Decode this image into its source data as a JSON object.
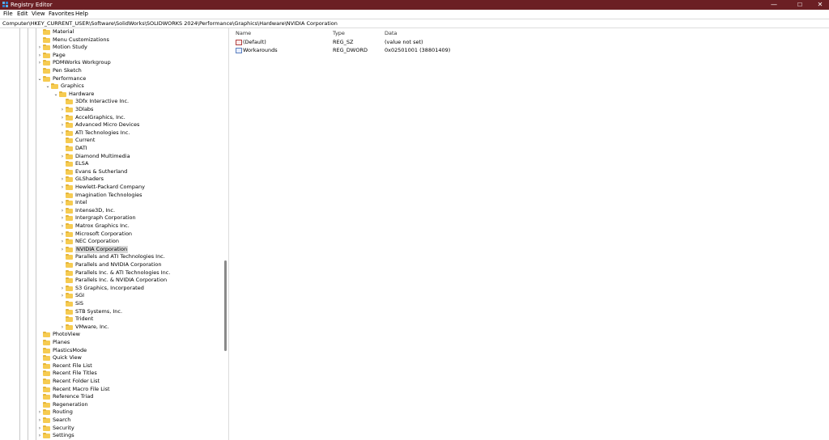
{
  "window": {
    "title": "Registry Editor",
    "controls": {
      "minimize": "—",
      "maximize": "☐",
      "close": "✕"
    }
  },
  "menu": [
    "File",
    "Edit",
    "View",
    "Favorites",
    "Help"
  ],
  "address": "Computer\\HKEY_CURRENT_USER\\Software\\SolidWorks\\SOLIDWORKS 2024\\Performance\\Graphics\\Hardware\\NVIDIA Corporation",
  "tree": [
    {
      "label": "Material",
      "level": 0,
      "expander": ""
    },
    {
      "label": "Menu Customizations",
      "level": 0,
      "expander": ""
    },
    {
      "label": "Motion Study",
      "level": 0,
      "expander": "collapsed"
    },
    {
      "label": "Page",
      "level": 0,
      "expander": "collapsed"
    },
    {
      "label": "PDMWorks Workgroup",
      "level": 0,
      "expander": "collapsed"
    },
    {
      "label": "Pen Sketch",
      "level": 0,
      "expander": ""
    },
    {
      "label": "Performance",
      "level": 0,
      "expander": "expanded"
    },
    {
      "label": "Graphics",
      "level": 1,
      "expander": "expanded"
    },
    {
      "label": "Hardware",
      "level": 2,
      "expander": "expanded"
    },
    {
      "label": "3Dfx Interactive Inc.",
      "level": 3,
      "expander": ""
    },
    {
      "label": "3Dlabs",
      "level": 3,
      "expander": "collapsed"
    },
    {
      "label": "AccelGraphics, Inc.",
      "level": 3,
      "expander": "collapsed"
    },
    {
      "label": "Advanced Micro Devices",
      "level": 3,
      "expander": "collapsed"
    },
    {
      "label": "ATI Technologies Inc.",
      "level": 3,
      "expander": "collapsed"
    },
    {
      "label": "Current",
      "level": 3,
      "expander": ""
    },
    {
      "label": "DATI",
      "level": 3,
      "expander": ""
    },
    {
      "label": "Diamond Multimedia",
      "level": 3,
      "expander": "collapsed"
    },
    {
      "label": "ELSA",
      "level": 3,
      "expander": ""
    },
    {
      "label": "Evans & Sutherland",
      "level": 3,
      "expander": ""
    },
    {
      "label": "GLShaders",
      "level": 3,
      "expander": "collapsed"
    },
    {
      "label": "Hewlett-Packard Company",
      "level": 3,
      "expander": "collapsed"
    },
    {
      "label": "Imagination Technologies",
      "level": 3,
      "expander": ""
    },
    {
      "label": "Intel",
      "level": 3,
      "expander": "collapsed"
    },
    {
      "label": "Intense3D, Inc.",
      "level": 3,
      "expander": "collapsed"
    },
    {
      "label": "Intergraph Corporation",
      "level": 3,
      "expander": "collapsed"
    },
    {
      "label": "Matrox Graphics Inc.",
      "level": 3,
      "expander": "collapsed"
    },
    {
      "label": "Microsoft Corporation",
      "level": 3,
      "expander": "collapsed"
    },
    {
      "label": "NEC Corporation",
      "level": 3,
      "expander": "collapsed"
    },
    {
      "label": "NVIDIA Corporation",
      "level": 3,
      "expander": "collapsed",
      "selected": true
    },
    {
      "label": "Parallels and ATI Technologies Inc.",
      "level": 3,
      "expander": ""
    },
    {
      "label": "Parallels and NVIDIA Corporation",
      "level": 3,
      "expander": ""
    },
    {
      "label": "Parallels Inc. & ATI Technologies Inc.",
      "level": 3,
      "expander": ""
    },
    {
      "label": "Parallels Inc. & NVIDIA Corporation",
      "level": 3,
      "expander": ""
    },
    {
      "label": "S3 Graphics, Incorporated",
      "level": 3,
      "expander": "collapsed"
    },
    {
      "label": "SGI",
      "level": 3,
      "expander": "collapsed"
    },
    {
      "label": "SiS",
      "level": 3,
      "expander": ""
    },
    {
      "label": "STB Systems, Inc.",
      "level": 3,
      "expander": ""
    },
    {
      "label": "Trident",
      "level": 3,
      "expander": ""
    },
    {
      "label": "VMware, Inc.",
      "level": 3,
      "expander": "collapsed"
    },
    {
      "label": "PhotoView",
      "level": 0,
      "expander": ""
    },
    {
      "label": "Planes",
      "level": 0,
      "expander": ""
    },
    {
      "label": "PlasticsMode",
      "level": 0,
      "expander": ""
    },
    {
      "label": "Quick View",
      "level": 0,
      "expander": ""
    },
    {
      "label": "Recent File List",
      "level": 0,
      "expander": ""
    },
    {
      "label": "Recent File Titles",
      "level": 0,
      "expander": ""
    },
    {
      "label": "Recent Folder List",
      "level": 0,
      "expander": ""
    },
    {
      "label": "Recent Macro File List",
      "level": 0,
      "expander": ""
    },
    {
      "label": "Reference Triad",
      "level": 0,
      "expander": ""
    },
    {
      "label": "Regeneration",
      "level": 0,
      "expander": ""
    },
    {
      "label": "Routing",
      "level": 0,
      "expander": "collapsed"
    },
    {
      "label": "Search",
      "level": 0,
      "expander": "collapsed"
    },
    {
      "label": "Security",
      "level": 0,
      "expander": "collapsed"
    },
    {
      "label": "Settings",
      "level": 0,
      "expander": "collapsed"
    }
  ],
  "values_table": {
    "headers": {
      "name": "Name",
      "type": "Type",
      "data": "Data"
    },
    "rows": [
      {
        "name": "(Default)",
        "type": "REG_SZ",
        "data": "(value not set)",
        "icon": "string-value-icon"
      },
      {
        "name": "Workarounds",
        "type": "REG_DWORD",
        "data": "0x02501001 (38801409)",
        "icon": "dword-value-icon"
      }
    ]
  },
  "colors": {
    "titlebar": "#6b1f24",
    "folder": "#f6cb51",
    "selection": "#d9d9d9"
  }
}
